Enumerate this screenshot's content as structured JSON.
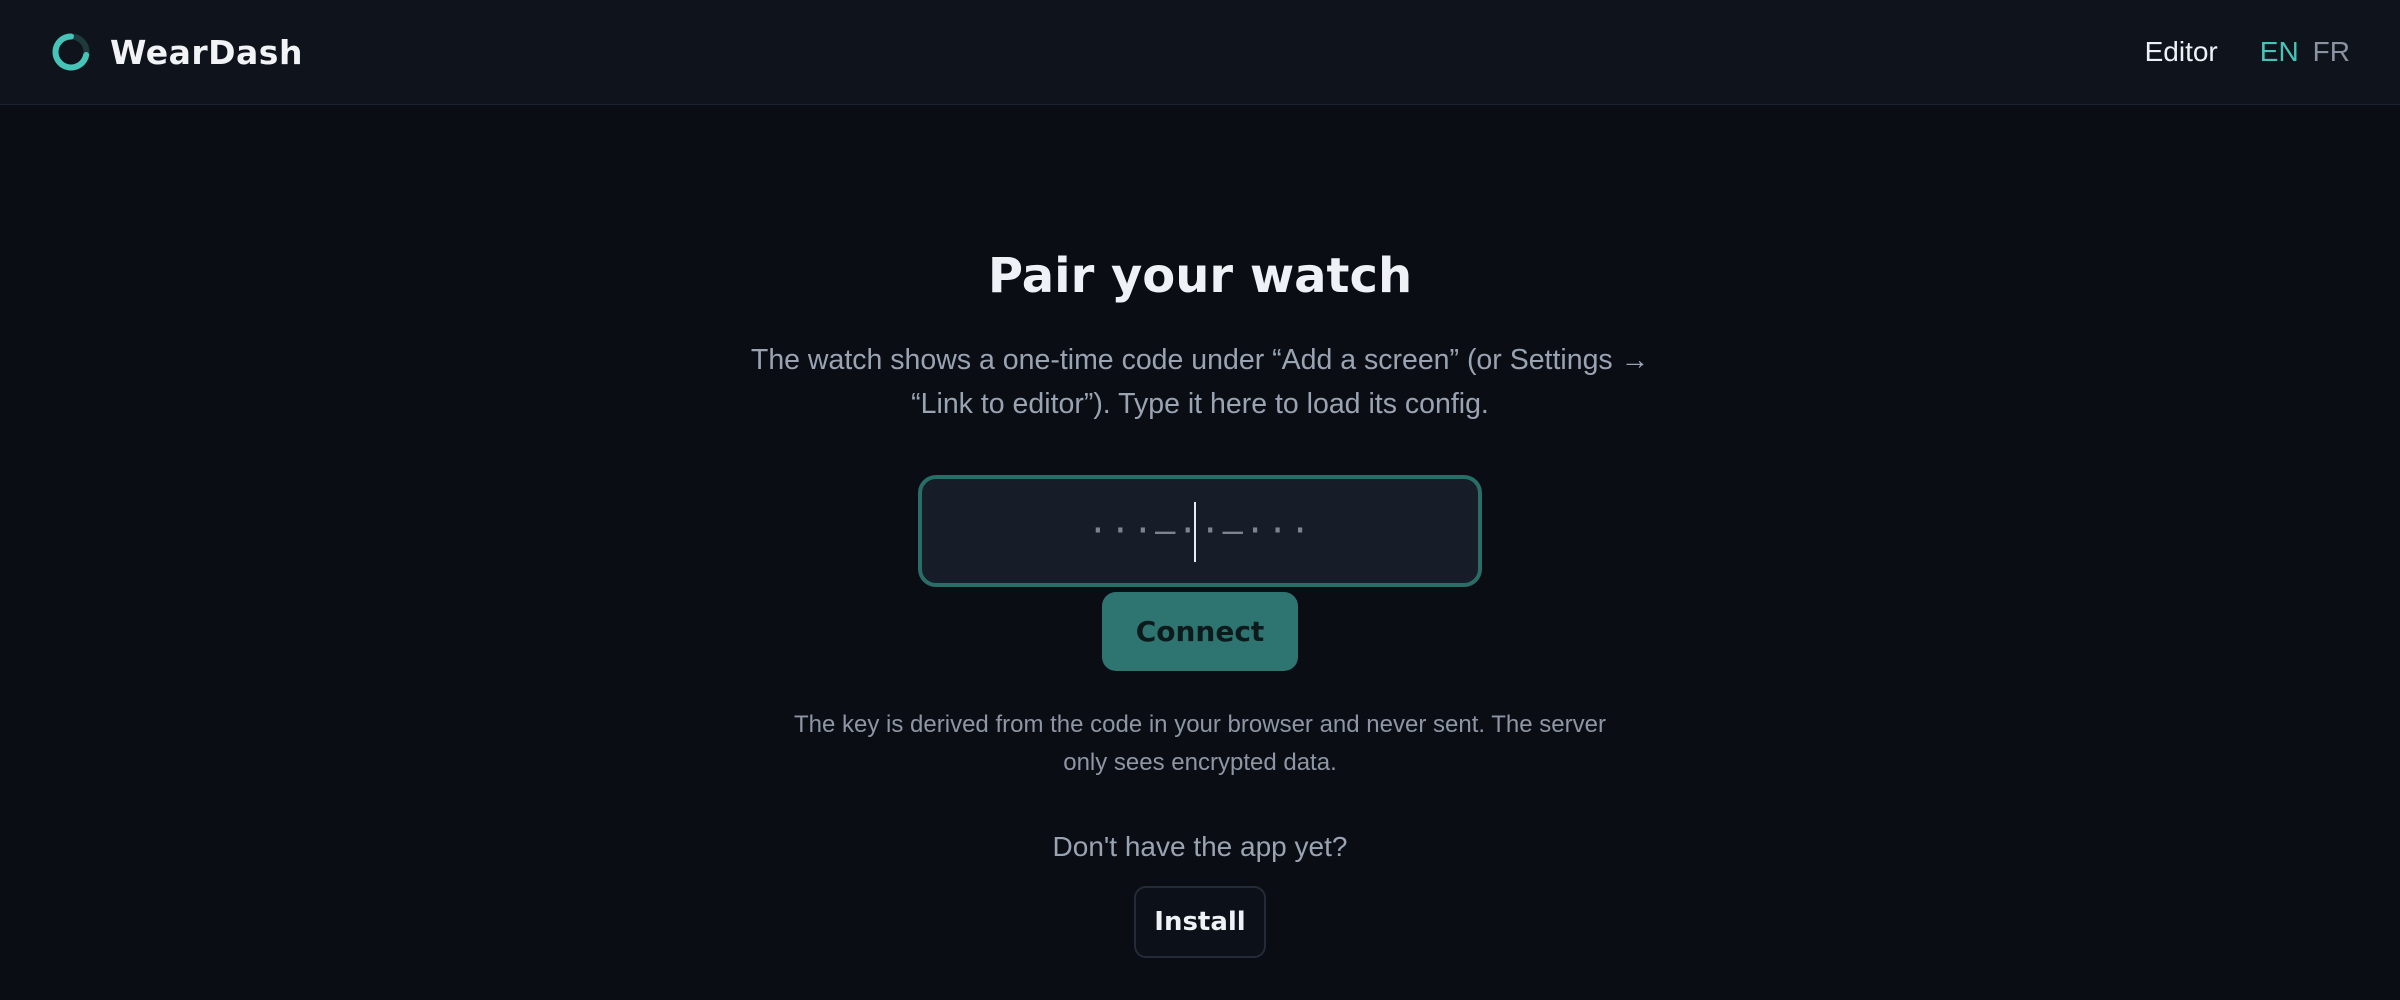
{
  "header": {
    "brand_name": "WearDash",
    "logo_icon": "ring-logo-icon",
    "nav": {
      "editor_label": "Editor",
      "languages": [
        {
          "code": "EN",
          "active": true
        },
        {
          "code": "FR",
          "active": false
        }
      ]
    }
  },
  "pairing": {
    "title": "Pair your watch",
    "subtitle": "The watch shows a one-time code under “Add a screen” (or Settings → “Link to editor”). Type it here to load its config.",
    "code_input": {
      "value": "",
      "placeholder": "···–··–···"
    },
    "connect_label": "Connect",
    "security_note": "The key is derived from the code in your browser and never sent. The server only sees encrypted data.",
    "app_question": "Don't have the app yet?",
    "install_label": "Install"
  },
  "colors": {
    "background": "#0a0e14",
    "header_background": "#0e131c",
    "accent": "#45c4b7",
    "input_border": "#2a6d66",
    "connect_button": "#2e7470"
  }
}
